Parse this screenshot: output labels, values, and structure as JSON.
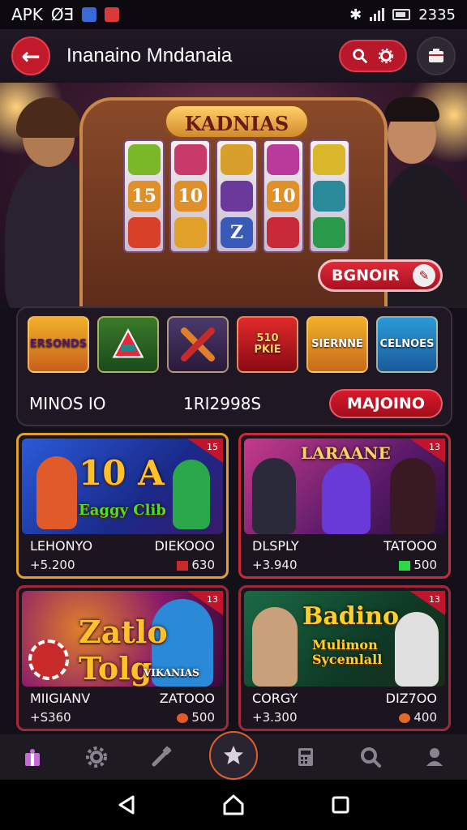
{
  "status_bar": {
    "left_text": "APK",
    "left_extra": "ØƎ",
    "time": "2335"
  },
  "app_bar": {
    "title": "Inanaino Mndanaia"
  },
  "hero": {
    "machine_title": "KADNIAS",
    "reel_symbols": [
      [
        "",
        "15",
        ""
      ],
      [
        "",
        "10",
        ""
      ],
      [
        "",
        "",
        "Z"
      ],
      [
        "",
        "10",
        ""
      ],
      [
        "",
        "",
        ""
      ]
    ],
    "bonus_button": "BGNOIR"
  },
  "categories": {
    "tiles": [
      "ERSONDS",
      "",
      "",
      "PKIE",
      "SIERNNE",
      "CELNOES"
    ],
    "tile_bold": [
      "",
      "",
      "",
      "510",
      "",
      ""
    ],
    "row_left": "MINOS IO",
    "row_mid": "1RI2998S",
    "row_button": "MAJOINO"
  },
  "games": [
    {
      "art_title": "10 A",
      "art_sub": "Eaggy Clib",
      "name": "LEHONYO",
      "amount": "+5.200",
      "label_right": "DIEKOOO",
      "value_right": "630",
      "badge": "15",
      "accent": "#2a60c8"
    },
    {
      "art_title": "LARAANE",
      "art_sub": "",
      "name": "DLSPLY",
      "amount": "+3.940",
      "label_right": "TATOOO",
      "value_right": "500",
      "badge": "13",
      "accent": "#a02a7a"
    },
    {
      "art_title": "Zatlo Tolg",
      "art_sub": "VIKANIAS",
      "name": "MIIGIANV",
      "amount": "+S360",
      "label_right": "ZATOOO",
      "value_right": "500",
      "badge": "13",
      "accent": "#6a1a70"
    },
    {
      "art_title": "Badino",
      "art_sub": "Mulimon Sycemlall",
      "name": "CORGY",
      "amount": "+3.300",
      "label_right": "DIZ7OO",
      "value_right": "400",
      "badge": "13",
      "accent": "#1a4a34"
    }
  ],
  "bottom_nav": [
    "gift-icon",
    "gear-icon",
    "tools-icon",
    "star-icon",
    "calculator-icon",
    "search-icon",
    "profile-icon"
  ],
  "colors": {
    "accent_red": "#c21a2a",
    "gold": "#ffd06a",
    "background": "#14101a"
  }
}
